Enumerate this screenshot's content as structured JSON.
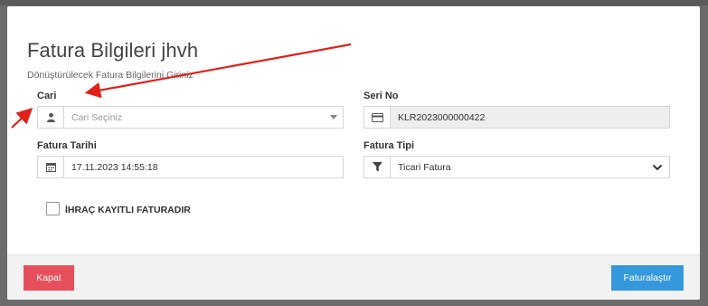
{
  "modal": {
    "title": "Fatura Bilgileri jhvh",
    "subtitle": "Dönüştürülecek Fatura Bilgilerini Giriniz"
  },
  "fields": {
    "cari": {
      "label": "Cari",
      "placeholder": "Cari Seçiniz",
      "icon": "user-icon"
    },
    "seri_no": {
      "label": "Seri No",
      "value": "KLR2023000000422",
      "icon": "credit-card-icon"
    },
    "fatura_tarihi": {
      "label": "Fatura Tarihi",
      "value": "17.11.2023 14:55:18",
      "icon": "calendar-icon"
    },
    "fatura_tipi": {
      "label": "Fatura Tipi",
      "value": "Ticari Fatura",
      "icon": "filter-icon"
    }
  },
  "ihrac": {
    "label": "İHRAÇ KAYITLI FATURADIR",
    "checked": false
  },
  "footer": {
    "close_label": "Kapat",
    "submit_label": "Faturalaştır"
  },
  "colors": {
    "close": "#e7505a",
    "submit": "#3598dc",
    "annotation": "#e0201a"
  }
}
